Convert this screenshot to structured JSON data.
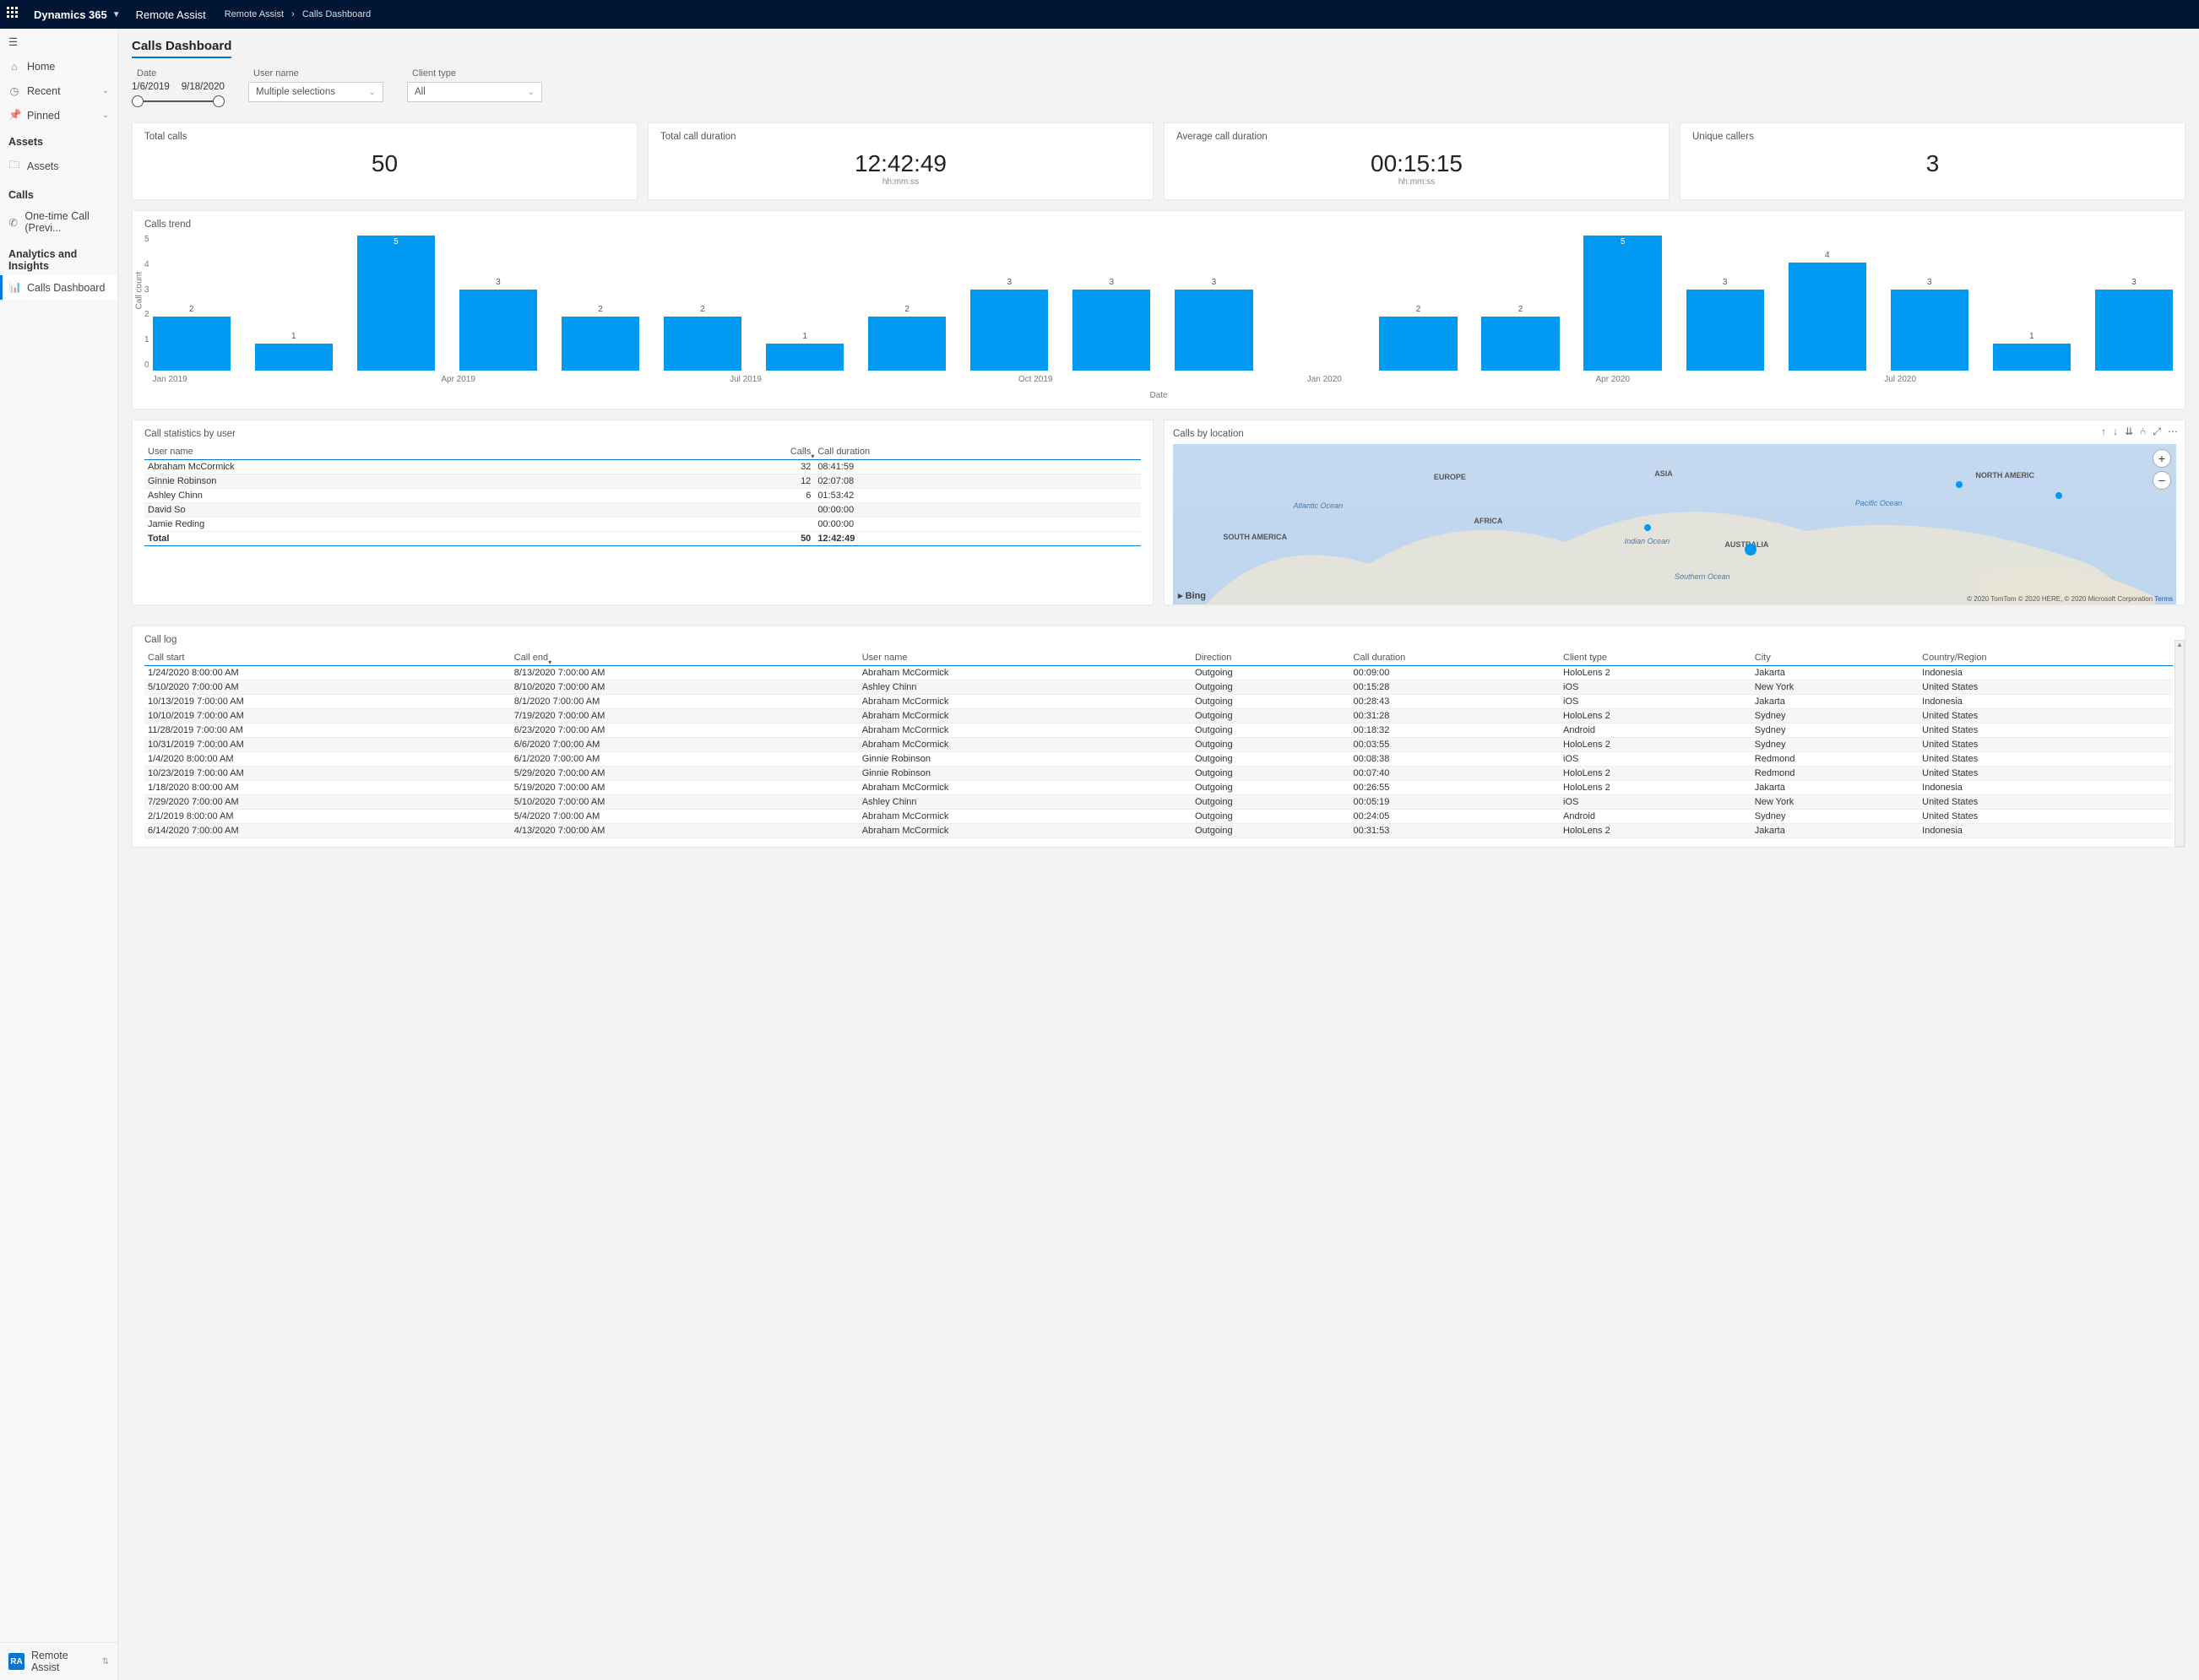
{
  "topbar": {
    "brand": "Dynamics 365",
    "area": "Remote Assist",
    "breadcrumb": [
      "Remote Assist",
      "Calls Dashboard"
    ]
  },
  "sidebar": {
    "home": "Home",
    "recent": "Recent",
    "pinned": "Pinned",
    "sections": {
      "assets": {
        "title": "Assets",
        "items": [
          "Assets"
        ]
      },
      "calls": {
        "title": "Calls",
        "items": [
          "One-time Call (Previ..."
        ]
      },
      "analytics": {
        "title": "Analytics and Insights",
        "items": [
          "Calls Dashboard"
        ]
      }
    },
    "footer": {
      "badge": "RA",
      "label": "Remote Assist"
    }
  },
  "page": {
    "title": "Calls Dashboard"
  },
  "filters": {
    "date": {
      "label": "Date",
      "from": "1/6/2019",
      "to": "9/18/2020"
    },
    "user": {
      "label": "User name",
      "value": "Multiple selections"
    },
    "client": {
      "label": "Client type",
      "value": "All"
    }
  },
  "cards": {
    "total_calls": {
      "title": "Total calls",
      "value": "50"
    },
    "total_duration": {
      "title": "Total call duration",
      "value": "12:42:49",
      "sub": "hh:mm:ss"
    },
    "avg_duration": {
      "title": "Average call duration",
      "value": "00:15:15",
      "sub": "hh:mm:ss"
    },
    "unique_callers": {
      "title": "Unique callers",
      "value": "3"
    }
  },
  "chart_data": {
    "type": "bar",
    "title": "Calls trend",
    "ylabel": "Call count",
    "xlabel": "Date",
    "ylim": [
      0,
      5
    ],
    "yticks": [
      0,
      1,
      2,
      3,
      4,
      5
    ],
    "categories": [
      "Jan 2019",
      "Feb 2019",
      "Mar 2019",
      "Apr 2019",
      "May 2019",
      "Jun 2019",
      "Jul 2019",
      "Aug 2019",
      "Sep 2019",
      "Oct 2019",
      "Nov 2019",
      "Dec 2019",
      "Jan 2020",
      "Feb 2020",
      "Mar 2020",
      "Apr 2020",
      "May 2020",
      "Jun 2020",
      "Jul 2020",
      "Aug 2020"
    ],
    "values": [
      2,
      1,
      5,
      3,
      2,
      2,
      1,
      2,
      3,
      3,
      3,
      null,
      2,
      2,
      5,
      3,
      4,
      3,
      1,
      3
    ],
    "x_tick_labels": [
      "Jan 2019",
      "Apr 2019",
      "Jul 2019",
      "Oct 2019",
      "Jan 2020",
      "Apr 2020",
      "Jul 2020"
    ]
  },
  "stats": {
    "title": "Call statistics by user",
    "columns": [
      "User name",
      "Calls",
      "Call duration"
    ],
    "rows": [
      {
        "user": "Abraham McCormick",
        "calls": 32,
        "dur": "08:41:59"
      },
      {
        "user": "Ginnie Robinson",
        "calls": 12,
        "dur": "02:07:08"
      },
      {
        "user": "Ashley Chinn",
        "calls": 6,
        "dur": "01:53:42"
      },
      {
        "user": "David So",
        "calls": "",
        "dur": "00:00:00"
      },
      {
        "user": "Jamie Reding",
        "calls": "",
        "dur": "00:00:00"
      }
    ],
    "total": {
      "label": "Total",
      "calls": 50,
      "dur": "12:42:49"
    }
  },
  "map": {
    "title": "Calls by location",
    "provider": "Bing",
    "attribution": "© 2020 TomTom © 2020 HERE, © 2020 Microsoft Corporation",
    "terms": "Terms",
    "continents": [
      "EUROPE",
      "ASIA",
      "NORTH AMERIC",
      "AFRICA",
      "SOUTH AMERICA",
      "AUSTRALIA"
    ],
    "oceans": [
      "Atlantic Ocean",
      "Indian Ocean",
      "Pacific Ocean",
      "Southern Ocean"
    ]
  },
  "log": {
    "title": "Call log",
    "columns": [
      "Call start",
      "Call end",
      "User name",
      "Direction",
      "Call duration",
      "Client type",
      "City",
      "Country/Region"
    ],
    "rows": [
      {
        "start": "1/24/2020 8:00:00 AM",
        "end": "8/13/2020 7:00:00 AM",
        "user": "Abraham McCormick",
        "dir": "Outgoing",
        "dur": "00:09:00",
        "client": "HoloLens 2",
        "city": "Jakarta",
        "country": "Indonesia"
      },
      {
        "start": "5/10/2020 7:00:00 AM",
        "end": "8/10/2020 7:00:00 AM",
        "user": "Ashley Chinn",
        "dir": "Outgoing",
        "dur": "00:15:28",
        "client": "iOS",
        "city": "New York",
        "country": "United States"
      },
      {
        "start": "10/13/2019 7:00:00 AM",
        "end": "8/1/2020 7:00:00 AM",
        "user": "Abraham McCormick",
        "dir": "Outgoing",
        "dur": "00:28:43",
        "client": "iOS",
        "city": "Jakarta",
        "country": "Indonesia"
      },
      {
        "start": "10/10/2019 7:00:00 AM",
        "end": "7/19/2020 7:00:00 AM",
        "user": "Abraham McCormick",
        "dir": "Outgoing",
        "dur": "00:31:28",
        "client": "HoloLens 2",
        "city": "Sydney",
        "country": "United States"
      },
      {
        "start": "11/28/2019 7:00:00 AM",
        "end": "6/23/2020 7:00:00 AM",
        "user": "Abraham McCormick",
        "dir": "Outgoing",
        "dur": "00:18:32",
        "client": "Android",
        "city": "Sydney",
        "country": "United States"
      },
      {
        "start": "10/31/2019 7:00:00 AM",
        "end": "6/6/2020 7:00:00 AM",
        "user": "Abraham McCormick",
        "dir": "Outgoing",
        "dur": "00:03:55",
        "client": "HoloLens 2",
        "city": "Sydney",
        "country": "United States"
      },
      {
        "start": "1/4/2020 8:00:00 AM",
        "end": "6/1/2020 7:00:00 AM",
        "user": "Ginnie Robinson",
        "dir": "Outgoing",
        "dur": "00:08:38",
        "client": "iOS",
        "city": "Redmond",
        "country": "United States"
      },
      {
        "start": "10/23/2019 7:00:00 AM",
        "end": "5/29/2020 7:00:00 AM",
        "user": "Ginnie Robinson",
        "dir": "Outgoing",
        "dur": "00:07:40",
        "client": "HoloLens 2",
        "city": "Redmond",
        "country": "United States"
      },
      {
        "start": "1/18/2020 8:00:00 AM",
        "end": "5/19/2020 7:00:00 AM",
        "user": "Abraham McCormick",
        "dir": "Outgoing",
        "dur": "00:26:55",
        "client": "HoloLens 2",
        "city": "Jakarta",
        "country": "Indonesia"
      },
      {
        "start": "7/29/2020 7:00:00 AM",
        "end": "5/10/2020 7:00:00 AM",
        "user": "Ashley Chinn",
        "dir": "Outgoing",
        "dur": "00:05:19",
        "client": "iOS",
        "city": "New York",
        "country": "United States"
      },
      {
        "start": "2/1/2019 8:00:00 AM",
        "end": "5/4/2020 7:00:00 AM",
        "user": "Abraham McCormick",
        "dir": "Outgoing",
        "dur": "00:24:05",
        "client": "Android",
        "city": "Sydney",
        "country": "United States"
      },
      {
        "start": "6/14/2020 7:00:00 AM",
        "end": "4/13/2020 7:00:00 AM",
        "user": "Abraham McCormick",
        "dir": "Outgoing",
        "dur": "00:31:53",
        "client": "HoloLens 2",
        "city": "Jakarta",
        "country": "Indonesia"
      }
    ]
  }
}
